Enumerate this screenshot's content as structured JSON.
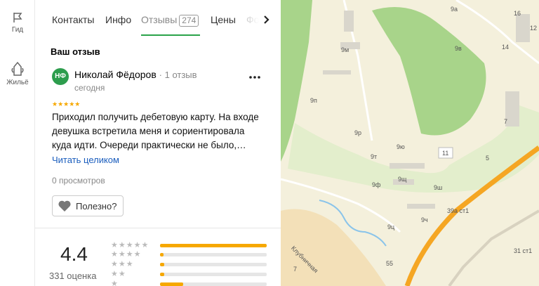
{
  "rail": {
    "items": [
      {
        "label": "Гид",
        "icon": "flag-icon"
      },
      {
        "label": "Жильё",
        "icon": "building-icon"
      }
    ]
  },
  "tabs": {
    "items": [
      "Контакты",
      "Инфо",
      "Отзывы",
      "Цены",
      "Фо"
    ],
    "active": "Отзывы",
    "review_count": "274"
  },
  "review_section": {
    "title": "Ваш отзыв",
    "avatar_initials": "НФ",
    "author": "Николай Фёдоров",
    "author_reviews": "1 отзыв",
    "date": "сегодня",
    "stars": "★★★★★",
    "text": "Приходил получить дебетовую карту. На входе девушка встретила меня и сориентировала куда идти. Очереди практически не было,…",
    "read_more": "Читать целиком",
    "views": "0 просмотров",
    "useful_label": "Полезно?"
  },
  "rating": {
    "value": "4.4",
    "count_label": "331 оценка",
    "distribution": [
      {
        "stars": "★★★★★",
        "fraction": 1.0
      },
      {
        "stars": "★★★★",
        "fraction": 0.03
      },
      {
        "stars": "★★★",
        "fraction": 0.04
      },
      {
        "stars": "★★",
        "fraction": 0.04
      },
      {
        "stars": "★",
        "fraction": 0.22
      }
    ]
  },
  "map": {
    "labels": [
      "9а",
      "9в",
      "9м",
      "16",
      "12",
      "14",
      "9п",
      "9р",
      "7",
      "9ю",
      "11",
      "9т",
      "5",
      "9щ",
      "9ф",
      "9ш",
      "39а ст1",
      "9ч",
      "9ц",
      "Клубничная",
      "55",
      "7",
      "31 ст1"
    ]
  },
  "colors": {
    "accent_green": "#2aa34a",
    "star_gold": "#f6a800",
    "link_blue": "#1a5dbd",
    "map_base": "#f4f0dc",
    "map_park": "#a8d48a",
    "map_road": "#f5a623"
  }
}
